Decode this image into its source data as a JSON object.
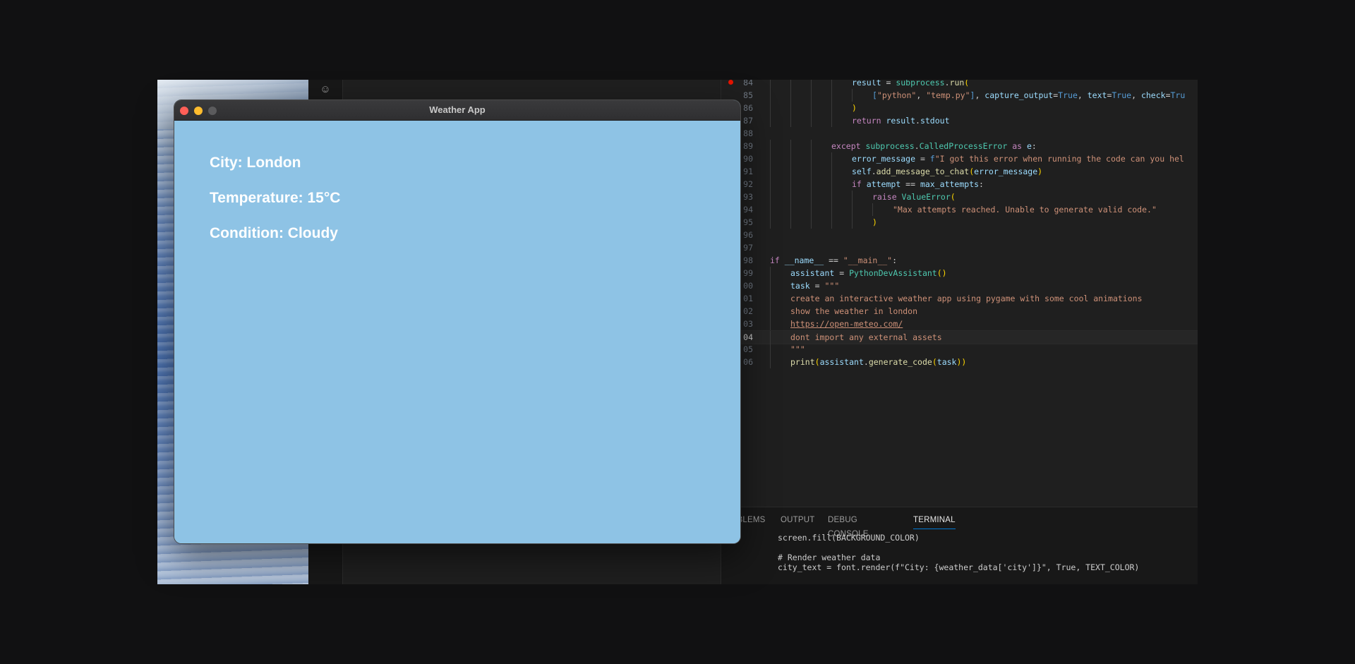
{
  "weather_app": {
    "title": "Weather App",
    "city": "City: London",
    "temperature": "Temperature: 15°C",
    "condition": "Condition: Cloudy",
    "background_color": "#8ec3e5"
  },
  "editor": {
    "lines": [
      {
        "num": "84",
        "breakpoint": true,
        "indent": 4,
        "parts": [
          [
            "result",
            "v"
          ],
          [
            " = ",
            "o"
          ],
          [
            "subprocess",
            "c"
          ],
          [
            ".",
            "o"
          ],
          [
            "run",
            "f"
          ],
          [
            "(",
            "p"
          ]
        ]
      },
      {
        "num": "85",
        "indent": 5,
        "parts": [
          [
            "[",
            "b"
          ],
          [
            "\"python\"",
            "s"
          ],
          [
            ", ",
            "o"
          ],
          [
            "\"temp.py\"",
            "s"
          ],
          [
            "]",
            "b"
          ],
          [
            ", ",
            "o"
          ],
          [
            "capture_output",
            "v"
          ],
          [
            "=",
            "o"
          ],
          [
            "True",
            "b"
          ],
          [
            ", ",
            "o"
          ],
          [
            "text",
            "v"
          ],
          [
            "=",
            "o"
          ],
          [
            "True",
            "b"
          ],
          [
            ", ",
            "o"
          ],
          [
            "check",
            "v"
          ],
          [
            "=",
            "o"
          ],
          [
            "Tru",
            "b"
          ]
        ]
      },
      {
        "num": "86",
        "indent": 4,
        "parts": [
          [
            ")",
            "p"
          ]
        ]
      },
      {
        "num": "87",
        "indent": 4,
        "parts": [
          [
            "return",
            "k"
          ],
          [
            " result",
            "v"
          ],
          [
            ".",
            "o"
          ],
          [
            "stdout",
            "v"
          ]
        ]
      },
      {
        "num": "88",
        "indent": 0,
        "parts": []
      },
      {
        "num": "89",
        "indent": 3,
        "parts": [
          [
            "except",
            "k"
          ],
          [
            " subprocess",
            "c"
          ],
          [
            ".",
            "o"
          ],
          [
            "CalledProcessError",
            "c"
          ],
          [
            " as ",
            "k"
          ],
          [
            "e",
            "v"
          ],
          [
            ":",
            "o"
          ]
        ]
      },
      {
        "num": "90",
        "indent": 4,
        "parts": [
          [
            "error_message",
            "v"
          ],
          [
            " = ",
            "o"
          ],
          [
            "f",
            "b"
          ],
          [
            "\"I got this error when running the code can you hel",
            "s"
          ]
        ]
      },
      {
        "num": "91",
        "indent": 4,
        "parts": [
          [
            "self",
            "v"
          ],
          [
            ".",
            "o"
          ],
          [
            "add_message_to_chat",
            "f"
          ],
          [
            "(",
            "p"
          ],
          [
            "error_message",
            "v"
          ],
          [
            ")",
            "p"
          ]
        ]
      },
      {
        "num": "92",
        "indent": 4,
        "parts": [
          [
            "if",
            "k"
          ],
          [
            " attempt",
            "v"
          ],
          [
            " == ",
            "o"
          ],
          [
            "max_attempts",
            "v"
          ],
          [
            ":",
            "o"
          ]
        ]
      },
      {
        "num": "93",
        "indent": 5,
        "parts": [
          [
            "raise",
            "k"
          ],
          [
            " ValueError",
            "c"
          ],
          [
            "(",
            "p"
          ]
        ]
      },
      {
        "num": "94",
        "indent": 6,
        "parts": [
          [
            "\"Max attempts reached. Unable to generate valid code.\"",
            "s"
          ]
        ]
      },
      {
        "num": "95",
        "indent": 5,
        "parts": [
          [
            ")",
            "p"
          ]
        ]
      },
      {
        "num": "96",
        "indent": 0,
        "parts": []
      },
      {
        "num": "97",
        "indent": 0,
        "parts": []
      },
      {
        "num": "98",
        "indent": 0,
        "parts": [
          [
            "if",
            "k"
          ],
          [
            " __name__",
            "v"
          ],
          [
            " == ",
            "o"
          ],
          [
            "\"__main__\"",
            "s"
          ],
          [
            ":",
            "o"
          ]
        ]
      },
      {
        "num": "99",
        "indent": 1,
        "parts": [
          [
            "assistant",
            "v"
          ],
          [
            " = ",
            "o"
          ],
          [
            "PythonDevAssistant",
            "c"
          ],
          [
            "()",
            "p"
          ]
        ]
      },
      {
        "num": "00",
        "indent": 1,
        "parts": [
          [
            "task",
            "v"
          ],
          [
            " = ",
            "o"
          ],
          [
            "\"\"\"",
            "s"
          ]
        ]
      },
      {
        "num": "01",
        "indent": 1,
        "parts": [
          [
            "create an interactive weather app using pygame with some cool animations",
            "s"
          ]
        ]
      },
      {
        "num": "02",
        "indent": 1,
        "parts": [
          [
            "show the weather in london",
            "s"
          ]
        ]
      },
      {
        "num": "03",
        "indent": 1,
        "parts": [
          [
            "https://open-meteo.com/",
            "u"
          ]
        ]
      },
      {
        "num": "04",
        "indent": 1,
        "active": true,
        "parts": [
          [
            "dont import any external assets",
            "s"
          ]
        ]
      },
      {
        "num": "05",
        "indent": 1,
        "parts": [
          [
            "\"\"\"",
            "s"
          ]
        ]
      },
      {
        "num": "06",
        "indent": 1,
        "parts": [
          [
            "print",
            "f"
          ],
          [
            "(",
            "p"
          ],
          [
            "assistant",
            "v"
          ],
          [
            ".",
            "o"
          ],
          [
            "generate_code",
            "f"
          ],
          [
            "(",
            "p"
          ],
          [
            "task",
            "v"
          ],
          [
            ")",
            "p"
          ],
          [
            ")",
            "p"
          ]
        ]
      }
    ]
  },
  "panel": {
    "tabs": [
      "PROBLEMS",
      "OUTPUT",
      "DEBUG CONSOLE",
      "TERMINAL"
    ],
    "active_tab": "TERMINAL",
    "terminal_lines": [
      "screen.fill(BACKGROUND_COLOR)",
      "",
      "# Render weather data",
      "city_text = font.render(f\"City: {weather_data['city']}\", True, TEXT_COLOR)"
    ]
  }
}
